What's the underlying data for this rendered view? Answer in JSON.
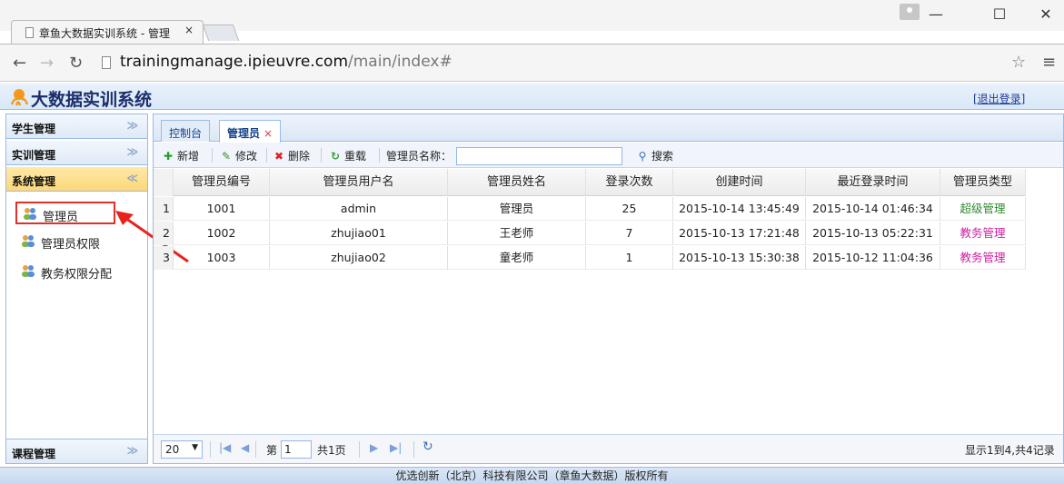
{
  "browser": {
    "tab_title": "章鱼大数据实训系统 - 管理",
    "tab_close": "×",
    "url_host": "trainingmanage.ipieuvre.com",
    "url_path": "/main/index#",
    "minimize": "—",
    "maximize": "☐",
    "close": "✕"
  },
  "app": {
    "title": "大数据实训系统",
    "logout": "[退出登录]"
  },
  "sidebar": {
    "sections": [
      {
        "label": "学生管理",
        "toggle": "≫"
      },
      {
        "label": "实训管理",
        "toggle": "≫"
      },
      {
        "label": "系统管理",
        "toggle": "≪"
      }
    ],
    "items": [
      {
        "label": "管理员"
      },
      {
        "label": "管理员权限"
      },
      {
        "label": "教务权限分配"
      }
    ],
    "bottom_section": {
      "label": "课程管理",
      "toggle": "≫"
    }
  },
  "tabs": [
    {
      "label": "控制台"
    },
    {
      "label": "管理员",
      "close": "×"
    }
  ],
  "toolbar": {
    "add": "新增",
    "edit": "修改",
    "delete": "删除",
    "reload": "重载",
    "name_label": "管理员名称：",
    "search": "搜索"
  },
  "grid": {
    "columns": [
      "管理员编号",
      "管理员用户名",
      "管理员姓名",
      "登录次数",
      "创建时间",
      "最近登录时间",
      "管理员类型"
    ],
    "rows": [
      {
        "num": "1",
        "id": "1001",
        "username": "admin",
        "name": "管理员",
        "logins": "25",
        "created": "2015-10-14 13:45:49",
        "last_login": "2015-10-14 01:46:34",
        "type": "超级管理",
        "type_color": "#2e8b2e"
      },
      {
        "num": "2",
        "id": "1002",
        "username": "zhujiao01",
        "name": "王老师",
        "logins": "7",
        "created": "2015-10-13 17:21:48",
        "last_login": "2015-10-13 05:22:31",
        "type": "教务管理",
        "type_color": "#d020a0"
      },
      {
        "num": "3",
        "id": "1003",
        "username": "zhujiao02",
        "name": "童老师",
        "logins": "1",
        "created": "2015-10-13 15:30:38",
        "last_login": "2015-10-12 11:04:36",
        "type": "教务管理",
        "type_color": "#d020a0"
      }
    ]
  },
  "pager": {
    "page_size": "20",
    "page_prefix": "第",
    "page_value": "1",
    "page_total": "共1页",
    "summary": "显示1到4,共4记录"
  },
  "footer": "优选创新（北京）科技有限公司（章鱼大数据）版权所有"
}
